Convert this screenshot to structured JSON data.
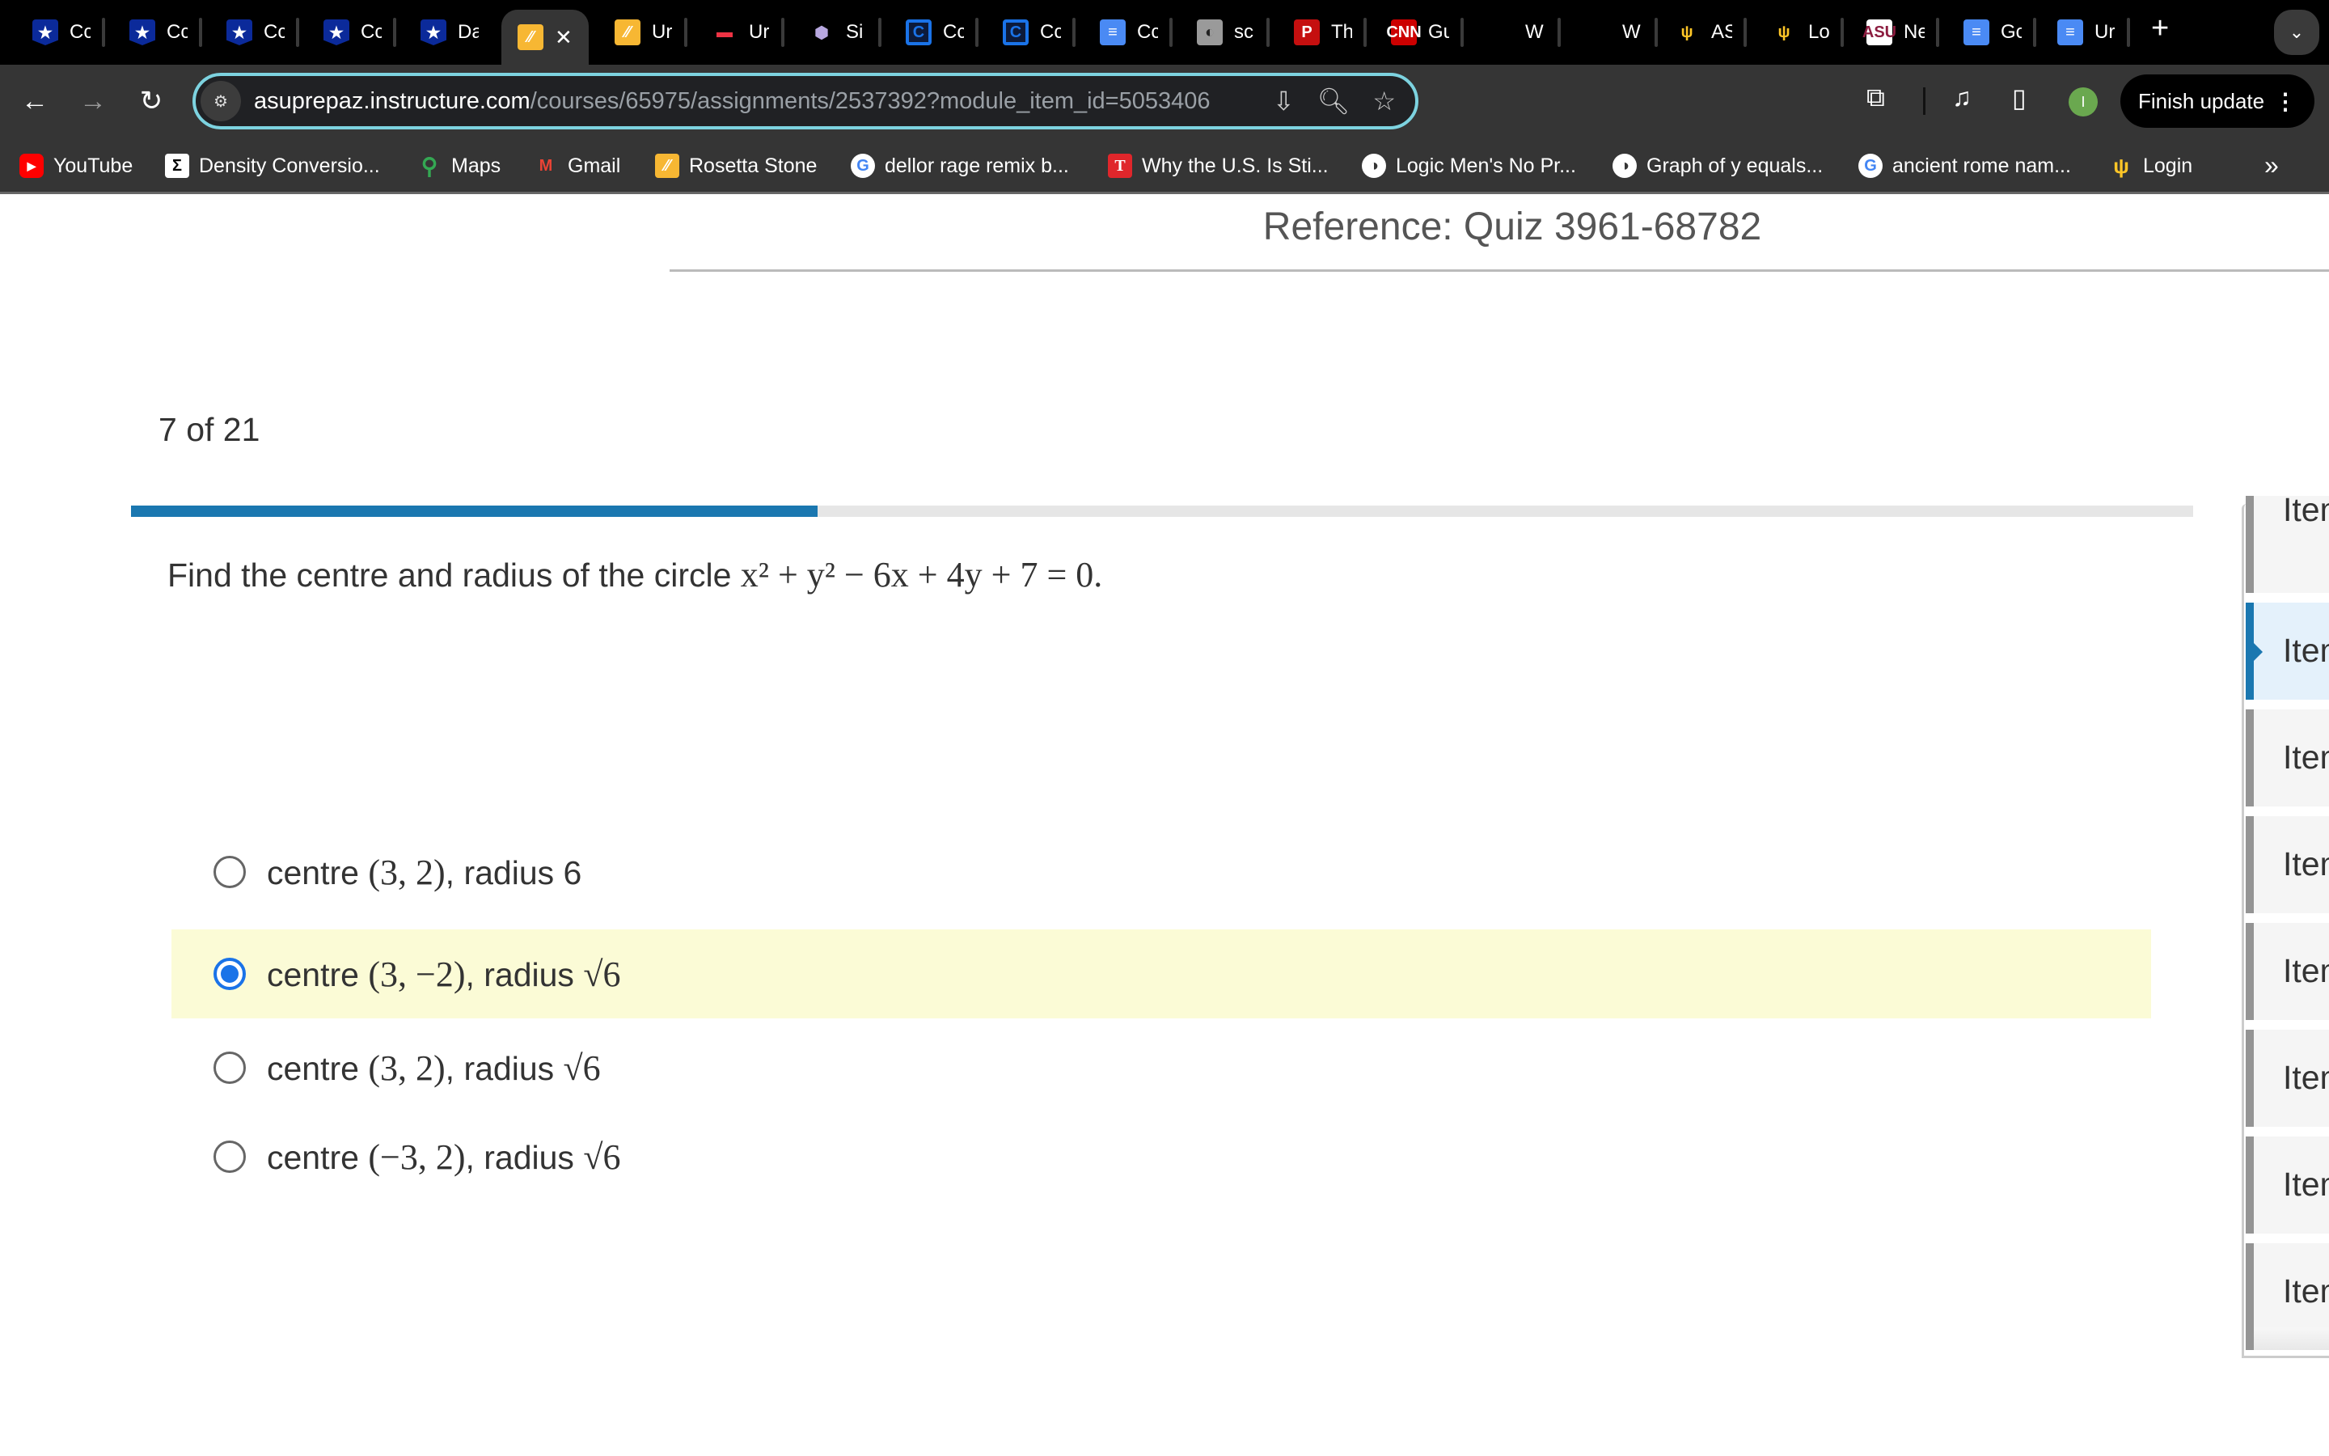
{
  "browser": {
    "tabs": [
      {
        "title": "Cc",
        "icon": "shield-star-icon"
      },
      {
        "title": "Cc",
        "icon": "shield-star-icon"
      },
      {
        "title": "Cc",
        "icon": "shield-star-icon"
      },
      {
        "title": "Cc",
        "icon": "shield-star-icon"
      },
      {
        "title": "Da",
        "icon": "shield-star-icon"
      },
      {
        "title": "",
        "icon": "rosetta-icon",
        "active": true,
        "close": "✕"
      },
      {
        "title": "Ur",
        "icon": "rosetta-icon"
      },
      {
        "title": "Ur",
        "icon": "colorbar-icon"
      },
      {
        "title": "Si",
        "icon": "hexagon-cluster-icon"
      },
      {
        "title": "Cc",
        "icon": "c-circle-icon"
      },
      {
        "title": "Cc",
        "icon": "c-circle-icon"
      },
      {
        "title": "Cc",
        "icon": "doc-lines-icon"
      },
      {
        "title": "sc",
        "icon": "globe-icon"
      },
      {
        "title": "Th",
        "icon": "p-icon"
      },
      {
        "title": "Gu",
        "icon": "cnn-icon"
      },
      {
        "title": "W",
        "icon": ""
      },
      {
        "title": "W",
        "icon": ""
      },
      {
        "title": "AS",
        "icon": "trident-icon"
      },
      {
        "title": "Lo",
        "icon": "trident-icon"
      },
      {
        "title": "Ne",
        "icon": "asu-icon"
      },
      {
        "title": "Gc",
        "icon": "google-docs-icon"
      },
      {
        "title": "Ur",
        "icon": "doc-lines-icon"
      }
    ],
    "new_tab": "+",
    "tab_menu": "⌄",
    "url_host": "asuprepaz.instructure.com",
    "url_path": "/courses/65975/assignments/2537392?module_item_id=5053406",
    "profile_initial": "I",
    "finish_update_label": "Finish update",
    "bookmarks": [
      {
        "label": "YouTube",
        "icon": "youtube-icon"
      },
      {
        "label": "Density Conversio...",
        "icon": "sigma-icon"
      },
      {
        "label": "Maps",
        "icon": "maps-pin-icon"
      },
      {
        "label": "Gmail",
        "icon": "gmail-icon"
      },
      {
        "label": "Rosetta Stone",
        "icon": "rosetta-icon"
      },
      {
        "label": "dellor rage remix b...",
        "icon": "google-icon"
      },
      {
        "label": "Why the U.S. Is Sti...",
        "icon": "t-icon"
      },
      {
        "label": "Logic Men's No Pr...",
        "icon": "globe-icon"
      },
      {
        "label": "Graph of y equals...",
        "icon": "globe-icon"
      },
      {
        "label": "ancient rome nam...",
        "icon": "google-icon"
      },
      {
        "label": "Login",
        "icon": "trident-icon"
      }
    ],
    "bookmarks_more": "»"
  },
  "quiz": {
    "reference": "Reference: Quiz 3961-68782",
    "counter": "7 of 21",
    "progress": {
      "current": 7,
      "total": 21,
      "fraction": 0.333
    },
    "question_text": "Find the centre and radius of the circle",
    "question_math": "x² + y² − 6x + 4y + 7 = 0.",
    "options": [
      {
        "prefix": "centre",
        "math": "(3, 2)",
        "suffix": ", radius 6",
        "radius_math": "",
        "selected": false
      },
      {
        "prefix": "centre",
        "math": "(3, −2)",
        "suffix": ", radius",
        "radius_math": "√6",
        "selected": true
      },
      {
        "prefix": "centre",
        "math": "(3, 2)",
        "suffix": ", radius",
        "radius_math": "√6",
        "selected": false
      },
      {
        "prefix": "centre",
        "math": "(−3, 2)",
        "suffix": ", radius",
        "radius_math": "√6",
        "selected": false
      }
    ],
    "highlight_color": "#fbfbd6",
    "accent_color": "#1a77b0"
  },
  "item_nav": {
    "items": [
      {
        "label": "Item",
        "current": false
      },
      {
        "label": "Item",
        "current": true
      },
      {
        "label": "Item",
        "current": false
      },
      {
        "label": "Item",
        "current": false
      },
      {
        "label": "Item",
        "current": false
      },
      {
        "label": "Item",
        "current": false
      },
      {
        "label": "Item",
        "current": false
      },
      {
        "label": "Item",
        "current": false
      }
    ]
  }
}
